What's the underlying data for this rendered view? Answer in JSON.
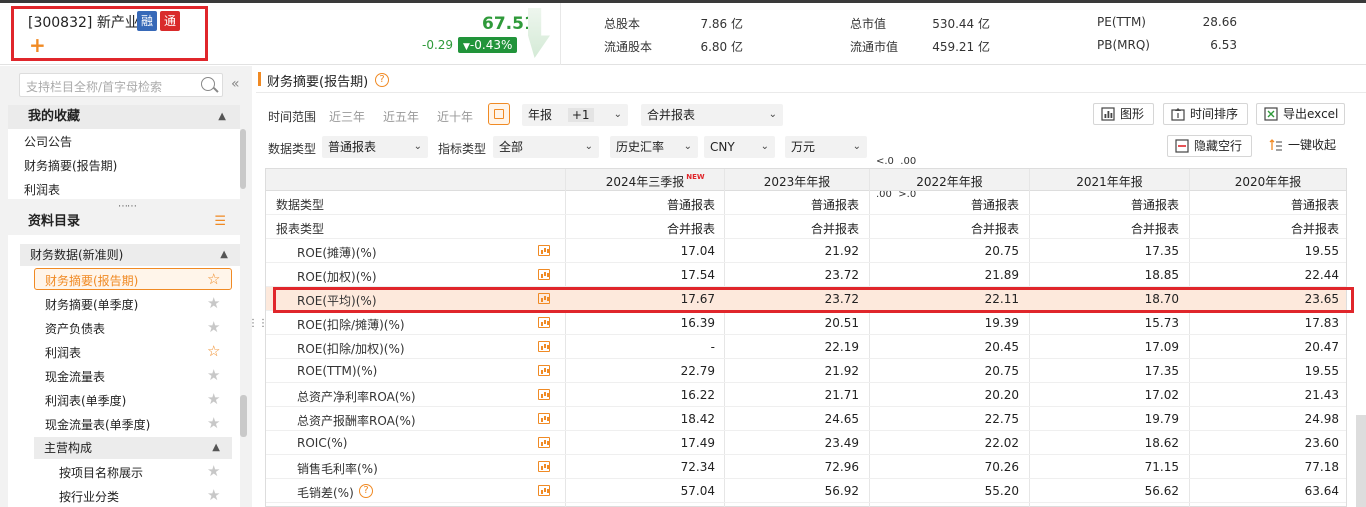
{
  "stock": {
    "code_name": "[300832] 新产业",
    "badge_rong": "融",
    "badge_tong": "通",
    "add": "+",
    "price": "67.51",
    "change": "-0.29",
    "change_pct": "-0.43%"
  },
  "quote": [
    {
      "label": "总股本",
      "value": "7.86 亿"
    },
    {
      "label": "流通股本",
      "value": "6.80 亿"
    },
    {
      "label": "总市值",
      "value": "530.44 亿"
    },
    {
      "label": "流通市值",
      "value": "459.21 亿"
    },
    {
      "label": "PE(TTM)",
      "value": "28.66"
    },
    {
      "label": "PB(MRQ)",
      "value": "6.53"
    }
  ],
  "sidebar": {
    "search_placeholder": "支持栏目全称/首字母检索",
    "collapse": "«",
    "fav_title": "我的收藏",
    "fav_items": [
      "公司公告",
      "财务摘要(报告期)",
      "利润表"
    ],
    "dir_title": "资料目录",
    "group1": "财务数据(新准则)",
    "items": [
      "财务摘要(报告期)",
      "财务摘要(单季度)",
      "资产负债表",
      "利润表",
      "现金流量表",
      "利润表(单季度)",
      "现金流量表(单季度)"
    ],
    "group2": "主营构成",
    "sub_items": [
      "按项目名称展示",
      "按行业分类"
    ]
  },
  "main": {
    "title": "财务摘要(报告期)",
    "help": "?",
    "time_range_label": "时间范围",
    "ranges": [
      "近三年",
      "近五年",
      "近十年"
    ],
    "period": "年报",
    "period_offset": "+1",
    "report_scope": "合并报表",
    "data_type_label": "数据类型",
    "data_type": "普通报表",
    "indicator_label": "指标类型",
    "indicator": "全部",
    "fx": "历史汇率",
    "currency": "CNY",
    "unit": "万元",
    "dec_top": "<.0  .00",
    "dec_bottom": ".00  >.0",
    "btn_chart": "图形",
    "btn_sort": "时间排序",
    "btn_export": "导出excel",
    "btn_hide_empty": "隐藏空行",
    "btn_collapse": "一键收起"
  },
  "table": {
    "columns": [
      "2024年三季报",
      "2023年年报",
      "2022年年报",
      "2021年年报",
      "2020年年报"
    ],
    "new_tag": "NEW",
    "meta_rows": [
      {
        "label": "数据类型",
        "values": [
          "普通报表",
          "普通报表",
          "普通报表",
          "普通报表",
          "普通报表"
        ]
      },
      {
        "label": "报表类型",
        "values": [
          "合并报表",
          "合并报表",
          "合并报表",
          "合并报表",
          "合并报表"
        ]
      }
    ],
    "rows": [
      {
        "label": "ROE(摊薄)(%)",
        "values": [
          "17.04",
          "21.92",
          "20.75",
          "17.35",
          "19.55"
        ]
      },
      {
        "label": "ROE(加权)(%)",
        "values": [
          "17.54",
          "23.72",
          "21.89",
          "18.85",
          "22.44"
        ]
      },
      {
        "label": "ROE(平均)(%)",
        "values": [
          "17.67",
          "23.72",
          "22.11",
          "18.70",
          "23.65"
        ]
      },
      {
        "label": "ROE(扣除/摊薄)(%)",
        "values": [
          "16.39",
          "20.51",
          "19.39",
          "15.73",
          "17.83"
        ]
      },
      {
        "label": "ROE(扣除/加权)(%)",
        "values": [
          "-",
          "22.19",
          "20.45",
          "17.09",
          "20.47"
        ]
      },
      {
        "label": "ROE(TTM)(%)",
        "values": [
          "22.79",
          "21.92",
          "20.75",
          "17.35",
          "19.55"
        ]
      },
      {
        "label": "总资产净利率ROA(%)",
        "values": [
          "16.22",
          "21.71",
          "20.20",
          "17.02",
          "21.43"
        ]
      },
      {
        "label": "总资产报酬率ROA(%)",
        "values": [
          "18.42",
          "24.65",
          "22.75",
          "19.79",
          "24.98"
        ]
      },
      {
        "label": "ROIC(%)",
        "values": [
          "17.49",
          "23.49",
          "22.02",
          "18.62",
          "23.60"
        ]
      },
      {
        "label": "销售毛利率(%)",
        "values": [
          "72.34",
          "72.96",
          "70.26",
          "71.15",
          "77.18"
        ]
      },
      {
        "label": "毛销差(%)",
        "values": [
          "57.04",
          "56.92",
          "55.20",
          "56.62",
          "63.64"
        ]
      }
    ]
  },
  "colors": {
    "accent": "#f08a24",
    "highlight": "#e0262b",
    "down": "#2f9a3a"
  }
}
